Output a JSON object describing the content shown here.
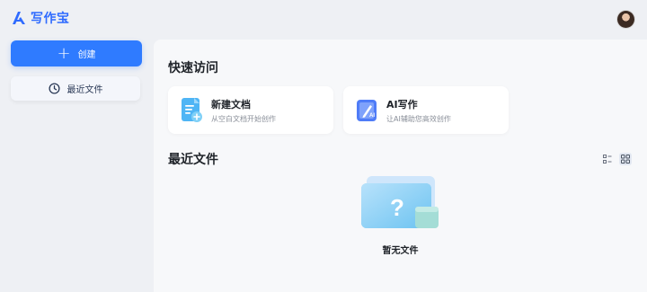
{
  "app": {
    "name": "写作宝",
    "brand_color": "#2f7bff"
  },
  "sidebar": {
    "create_label": "创建",
    "recent_label": "最近文件"
  },
  "quick_access": {
    "title": "快速访问",
    "cards": [
      {
        "title": "新建文档",
        "subtitle": "从空白文档开始创作",
        "icon": "new-document-icon"
      },
      {
        "title": "AI写作",
        "subtitle": "让AI辅助您高效创作",
        "icon": "ai-writing-icon"
      }
    ]
  },
  "recent_files": {
    "title": "最近文件",
    "empty_text": "暂无文件",
    "view_modes": [
      "list-view-icon",
      "grid-view-icon"
    ],
    "active_view": "grid"
  }
}
